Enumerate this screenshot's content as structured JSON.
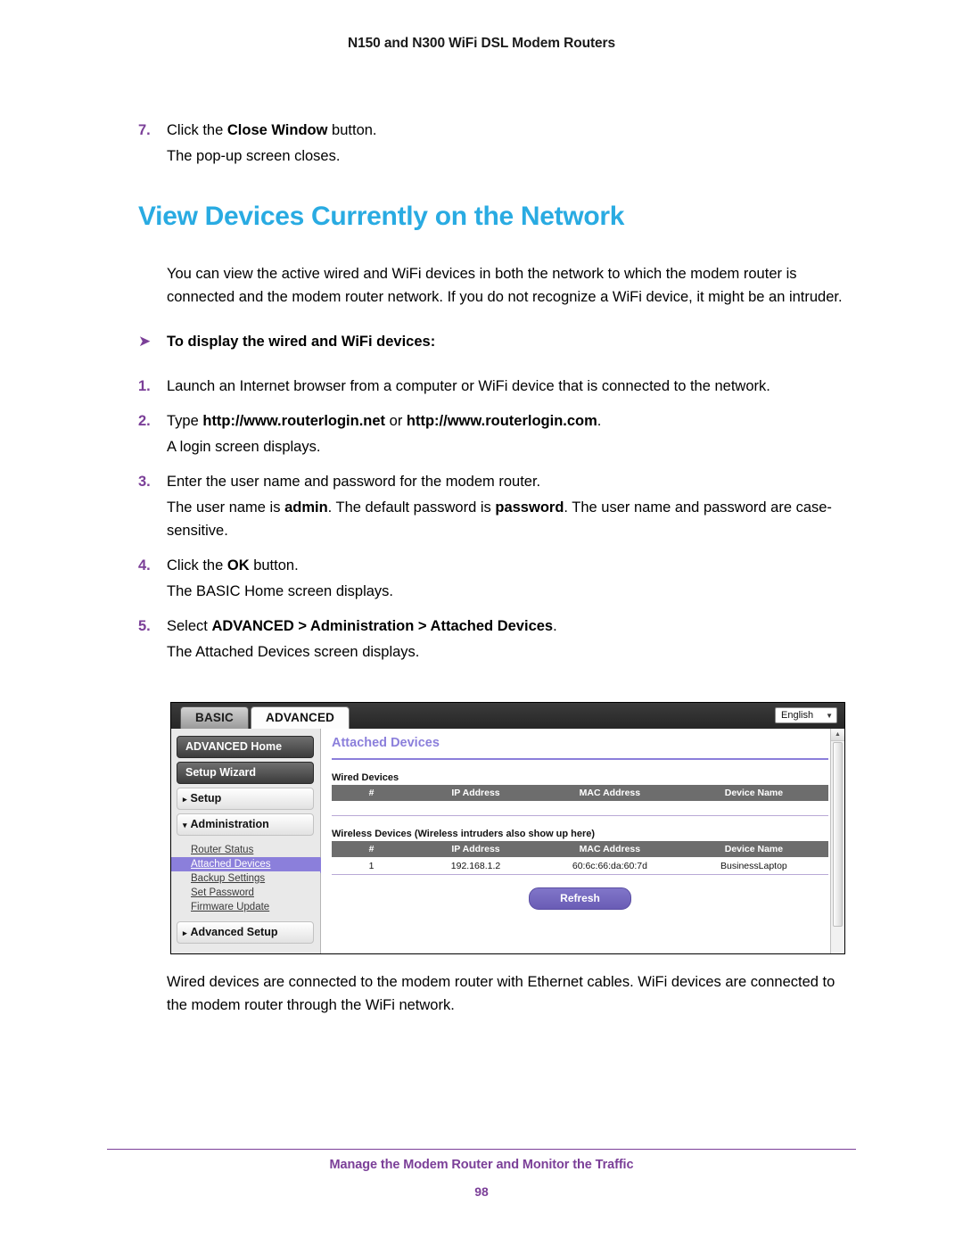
{
  "header": {
    "running_title": "N150 and N300 WiFi DSL Modem Routers"
  },
  "steps_before": {
    "num7": "7.",
    "step7_prefix": "Click the ",
    "step7_bold": "Close Window",
    "step7_suffix": " button.",
    "step7_result": "The pop-up screen closes."
  },
  "section": {
    "title": "View Devices Currently on the Network",
    "intro": "You can view the active wired and WiFi devices in both the network to which the modem router is connected and the modem router network. If you do not recognize a WiFi device, it might be an intruder.",
    "procedure_arrow": "➤",
    "procedure_heading": "To display the wired and WiFi devices:"
  },
  "steps": [
    {
      "num": "1.",
      "text": "Launch an Internet browser from a computer or WiFi device that is connected to the network."
    },
    {
      "num": "2.",
      "prefix": "Type ",
      "bold1": "http://www.routerlogin.net",
      "mid": " or ",
      "bold2": "http://www.routerlogin.com",
      "suffix": ".",
      "result": "A login screen displays."
    },
    {
      "num": "3.",
      "text": "Enter the user name and password for the modem router.",
      "result_prefix": "The user name is ",
      "result_bold1": "admin",
      "result_mid": ". The default password is ",
      "result_bold2": "password",
      "result_suffix": ". The user name and password are case-sensitive."
    },
    {
      "num": "4.",
      "prefix": "Click the ",
      "bold1": "OK",
      "suffix": " button.",
      "result": "The BASIC Home screen displays."
    },
    {
      "num": "5.",
      "prefix": "Select ",
      "bold1": "ADVANCED > Administration > Attached Devices",
      "suffix": ".",
      "result": "The Attached Devices screen displays."
    }
  ],
  "router_ui": {
    "tabs": [
      {
        "label": "BASIC",
        "active": false
      },
      {
        "label": "ADVANCED",
        "active": true
      }
    ],
    "language": {
      "value": "English",
      "caret": "▼"
    },
    "sidebar": {
      "buttons": [
        "ADVANCED Home",
        "Setup Wizard"
      ],
      "accordions": [
        {
          "caret": "▸",
          "label": "Setup"
        },
        {
          "caret": "▾",
          "label": "Administration"
        }
      ],
      "links": [
        {
          "label": "Router Status",
          "selected": false
        },
        {
          "label": "Attached Devices",
          "selected": true
        },
        {
          "label": "Backup Settings",
          "selected": false
        },
        {
          "label": "Set Password",
          "selected": false
        },
        {
          "label": "Firmware Update",
          "selected": false
        }
      ],
      "accordion_bottom": {
        "caret": "▸",
        "label": "Advanced Setup"
      }
    },
    "page_title": "Attached Devices",
    "wired": {
      "label": "Wired Devices",
      "columns": [
        "#",
        "IP Address",
        "MAC Address",
        "Device Name"
      ],
      "rows": []
    },
    "wireless": {
      "label": "Wireless Devices (Wireless intruders also show up here)",
      "columns": [
        "#",
        "IP Address",
        "MAC Address",
        "Device Name"
      ],
      "rows": [
        {
          "index": "1",
          "ip": "192.168.1.2",
          "mac": "60:6c:66:da:60:7d",
          "name": "BusinessLaptop"
        }
      ]
    },
    "refresh_label": "Refresh",
    "scroll_up_arrow": "▲"
  },
  "closing_paragraph": "Wired devices are connected to the modem router with Ethernet cables. WiFi devices are connected to the modem router through the WiFi network.",
  "footer": {
    "chapter": "Manage the Modem Router and Monitor the Traffic",
    "page_number": "98"
  },
  "colors": {
    "heading_blue": "#29ABE2",
    "accent_purple": "#7b3f98",
    "ui_purple": "#8b7fdb"
  }
}
